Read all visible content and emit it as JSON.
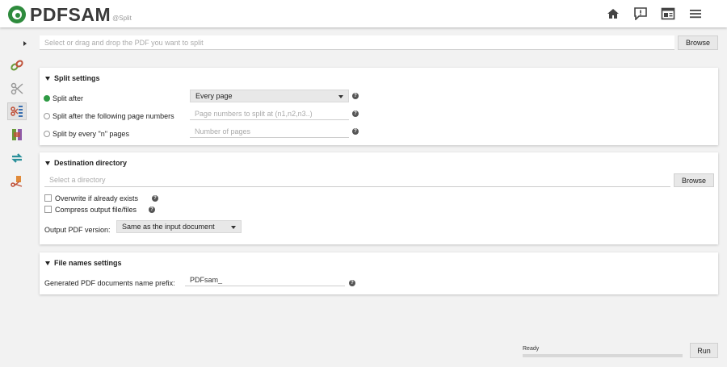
{
  "app": {
    "logo_text": "PDFSAM",
    "logo_subtitle": "@Split"
  },
  "topbar": {
    "icons": [
      "home-icon",
      "news-icon",
      "dashboard-icon",
      "menu-icon"
    ]
  },
  "sidebar": {
    "items": [
      "merge-icon",
      "split-icon",
      "split-by-bookmarks-icon",
      "rotate-icon",
      "alternate-mix-icon",
      "extract-icon"
    ]
  },
  "input": {
    "placeholder": "Select or drag and drop the PDF you want to split",
    "value": "",
    "browse_label": "Browse"
  },
  "split_settings": {
    "title": "Split settings",
    "options": [
      {
        "label": "Split after",
        "checked": true
      },
      {
        "label": "Split after the following page numbers",
        "checked": false
      },
      {
        "label": "Split by every \"n\" pages",
        "checked": false
      }
    ],
    "split_after_value": "Every page",
    "page_numbers_placeholder": "Page numbers to split at (n1,n2,n3..)",
    "n_pages_placeholder": "Number of pages"
  },
  "destination": {
    "title": "Destination directory",
    "directory_placeholder": "Select a directory",
    "browse_label": "Browse",
    "overwrite_label": "Overwrite if already exists",
    "compress_label": "Compress output file/files",
    "version_label": "Output PDF version:",
    "version_value": "Same as the input document"
  },
  "file_names": {
    "title": "File names settings",
    "prefix_label": "Generated PDF documents name prefix:",
    "prefix_value": "PDFsam_"
  },
  "footer": {
    "status": "Ready",
    "progress_percent": 0,
    "run_label": "Run"
  },
  "colors": {
    "accent": "#2e9a44",
    "brand": "#2e8b3d"
  }
}
